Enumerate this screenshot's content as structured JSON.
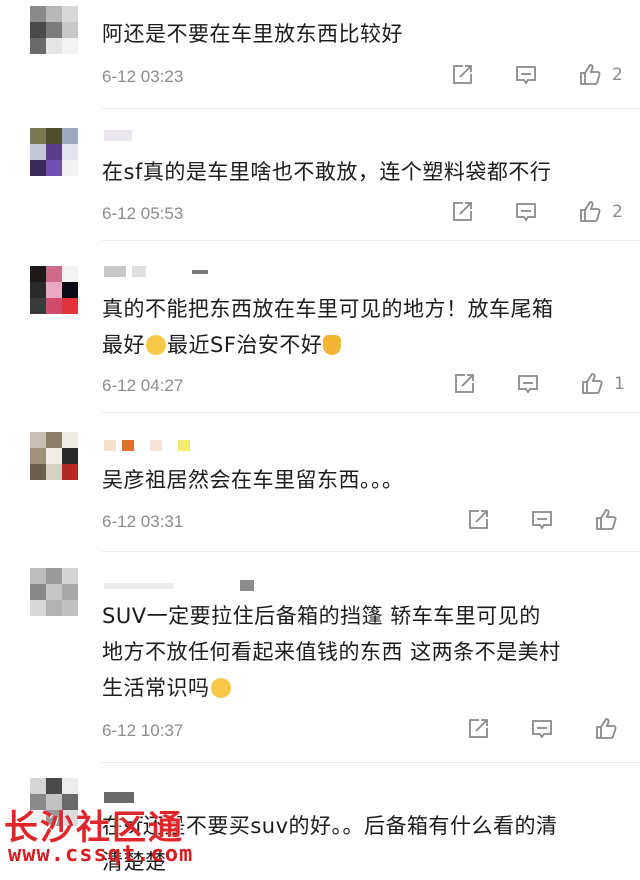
{
  "comments": [
    {
      "text": "阿还是不要在车里放东西比较好",
      "date": "6-12 03:23",
      "likes": "2"
    },
    {
      "text": "在sf真的是车里啥也不敢放，连个塑料袋都不行",
      "date": "6-12 05:53",
      "likes": "2"
    },
    {
      "text_line1": "真的不能把东西放在车里可见的地方！放车尾箱",
      "text_line2a": "最好",
      "text_line2b": "最近SF治安不好",
      "date": "6-12 04:27",
      "likes": "1"
    },
    {
      "text": "吴彦祖居然会在车里留东西。。。",
      "date": "6-12 03:31",
      "likes": ""
    },
    {
      "text_line1": "SUV一定要拉住后备箱的挡篷 轿车车里可见的",
      "text_line2": "地方不放任何看起来值钱的东西 这两条不是美村",
      "text_line3": "生活常识吗",
      "date": "6-12 10:37",
      "likes": ""
    },
    {
      "text_line1": "在sf还是不要买suv的好。。后备箱有什么看的清",
      "text_line2": "清楚楚"
    }
  ],
  "watermark": {
    "title": "长沙社区通",
    "url": "www.cssqt.com"
  },
  "icons": {
    "share": "share-icon",
    "comment": "comment-icon",
    "like": "thumbs-up-icon"
  },
  "colors": {
    "meta_gray": "#8c8c8c",
    "icon_gray": "#8a8a8a",
    "watermark_red": "#e0262a"
  }
}
